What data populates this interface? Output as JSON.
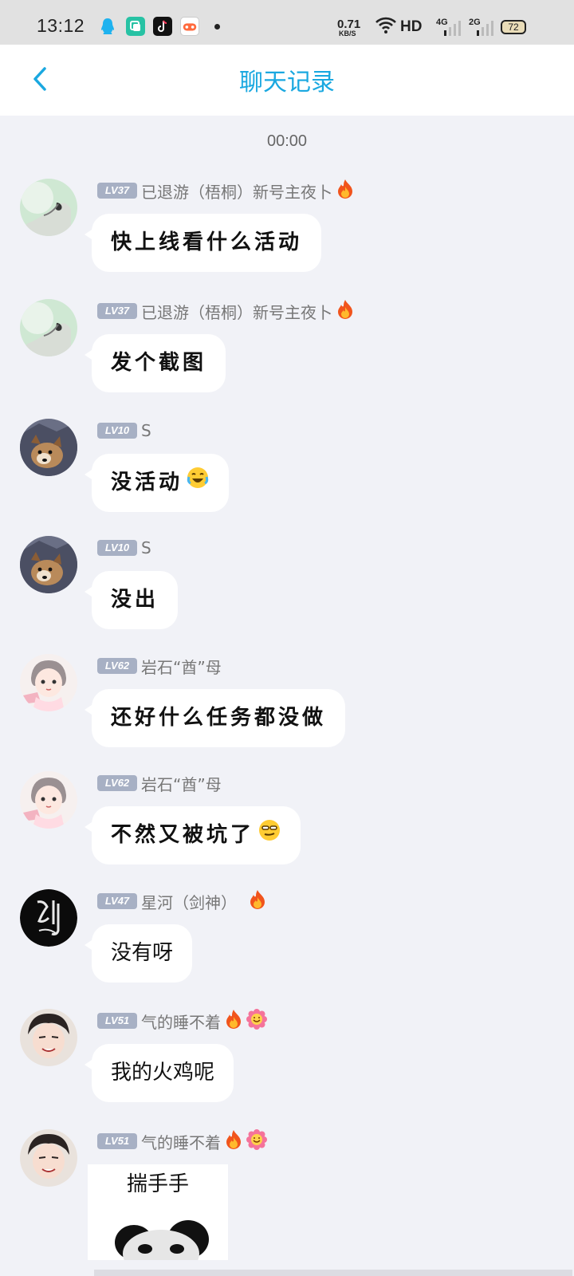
{
  "status_bar": {
    "time": "13:12",
    "net_speed": "0.71",
    "net_unit": "KB/S",
    "hd": "HD",
    "sig1": "4G",
    "sig2": "2G",
    "battery": "72"
  },
  "header": {
    "title": "聊天记录"
  },
  "timestamp": "00:00",
  "messages": [
    {
      "level": "LV37",
      "name": "已退游（梧桐）新号主夜卜",
      "text": "快上线看什么活动"
    },
    {
      "level": "LV37",
      "name": "已退游（梧桐）新号主夜卜",
      "text": "发个截图"
    },
    {
      "level": "LV10",
      "name": "S",
      "text": "没活动"
    },
    {
      "level": "LV10",
      "name": "S",
      "text": "没出"
    },
    {
      "level": "LV62",
      "name": "岩石“酋”母",
      "text": "还好什么任务都没做"
    },
    {
      "level": "LV62",
      "name": "岩石“酋”母",
      "text": "不然又被坑了"
    },
    {
      "level": "LV47",
      "name": "星河（剑神）",
      "text": "没有呀"
    },
    {
      "level": "LV51",
      "name": "气的睡不着",
      "text": "我的火鸡呢"
    },
    {
      "level": "LV51",
      "name": "气的睡不着",
      "sticker_text": "揣手手"
    }
  ],
  "colors": {
    "accent": "#1aa8e0",
    "background": "#f1f2f7",
    "level_badge": "#a7b0c4"
  }
}
